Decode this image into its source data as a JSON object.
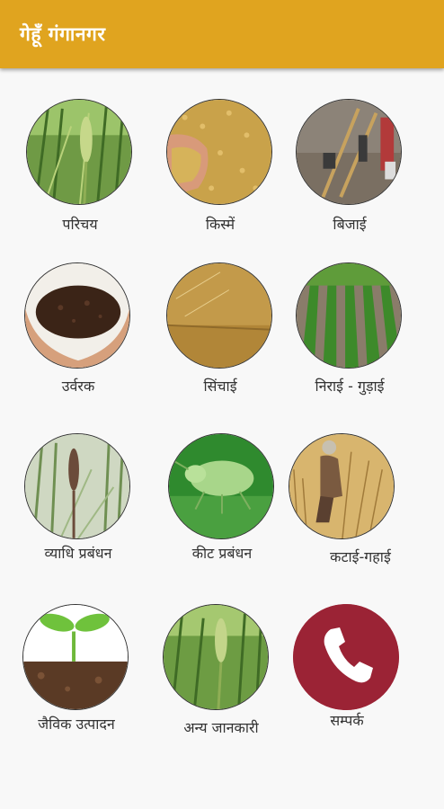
{
  "app": {
    "title": "गेहूँ  गंगानगर"
  },
  "menu": {
    "items": [
      {
        "label": "परिचय",
        "icon": "wheat-field-icon"
      },
      {
        "label": "किस्में",
        "icon": "wheat-grains-icon"
      },
      {
        "label": "बिजाई",
        "icon": "seed-drill-icon"
      },
      {
        "label": "उर्वरक",
        "icon": "soil-hands-icon"
      },
      {
        "label": "सिंचाई",
        "icon": "irrigation-icon"
      },
      {
        "label": "निराई  -  गुड़ाई",
        "icon": "crop-rows-icon"
      },
      {
        "label": "व्याधि  प्रबंधन",
        "icon": "diseased-wheat-icon"
      },
      {
        "label": "कीट  प्रबंधन",
        "icon": "aphid-insect-icon"
      },
      {
        "label": "कटाई-गहाई",
        "icon": "harvest-icon"
      },
      {
        "label": "जैविक  उत्पादन",
        "icon": "seedling-icon"
      },
      {
        "label": "अन्य  जानकारी",
        "icon": "green-wheat-icon"
      },
      {
        "label": "सम्पर्क",
        "icon": "phone-icon"
      }
    ]
  },
  "colors": {
    "appbar": "#e0a41f",
    "contact": "#9b2335",
    "background": "#f8f8f8"
  }
}
